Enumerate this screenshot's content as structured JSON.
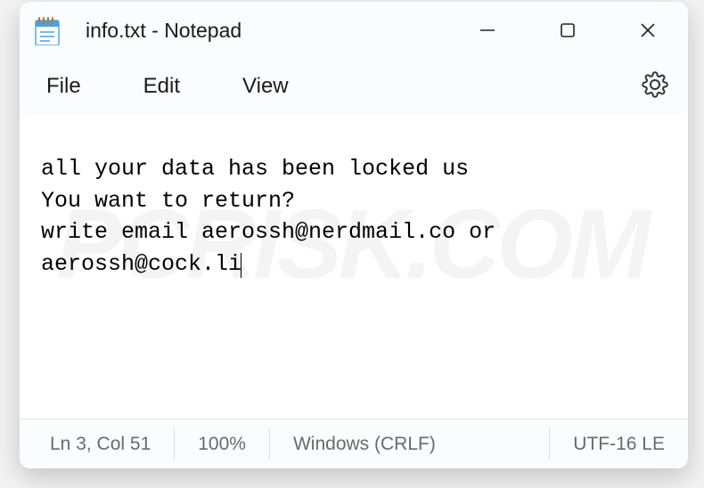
{
  "titlebar": {
    "title": "info.txt - Notepad"
  },
  "menubar": {
    "file": "File",
    "edit": "Edit",
    "view": "View"
  },
  "document": {
    "text": "all your data has been locked us\nYou want to return?\nwrite email aerossh@nerdmail.co or aerossh@cock.li"
  },
  "statusbar": {
    "position": "Ln 3, Col 51",
    "zoom": "100%",
    "eol": "Windows (CRLF)",
    "encoding": "UTF-16 LE"
  },
  "icons": {
    "notepad": "notepad-icon",
    "minimize": "minimize-icon",
    "maximize": "maximize-icon",
    "close": "close-icon",
    "settings": "gear-icon"
  },
  "watermark": "PCRISK.COM"
}
